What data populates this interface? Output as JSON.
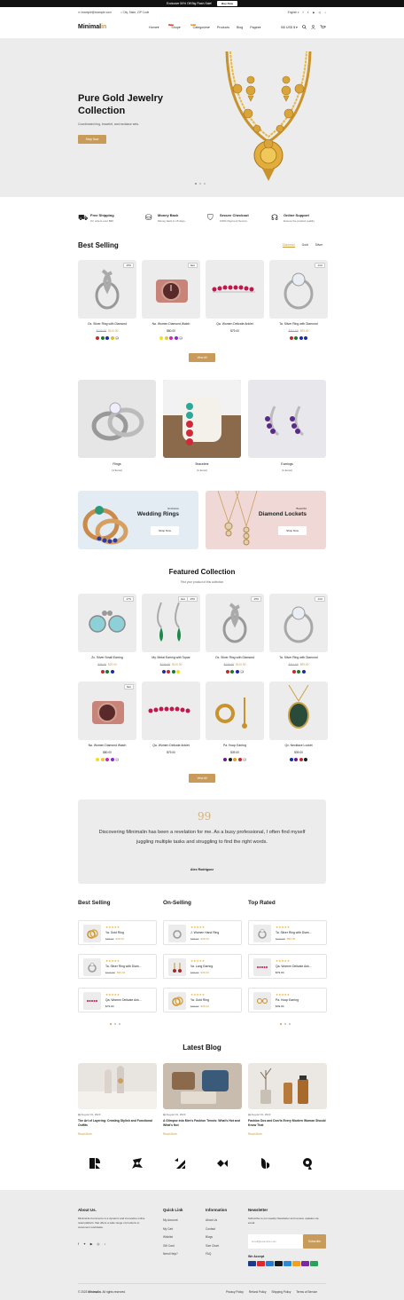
{
  "topbar": {
    "promo": "Exclusive 50% Off Big Flash Sale!",
    "buy": "Buy Now"
  },
  "infobar": {
    "email": "example@example.com",
    "address": "City, State, ZIP Code",
    "language": "English"
  },
  "header": {
    "logo_main": "Minimal",
    "logo_accent": "in",
    "currency": "BD USD $",
    "cart_count": "0",
    "nav": [
      {
        "label": "Home",
        "caret": "▾"
      },
      {
        "label": "Shop",
        "caret": "▾",
        "tag": "Sale"
      },
      {
        "label": "Categories",
        "caret": "▾",
        "tag": "New"
      },
      {
        "label": "Products"
      },
      {
        "label": "Blog"
      },
      {
        "label": "Pages",
        "caret": "▾"
      }
    ]
  },
  "hero": {
    "title": "Pure Gold Jewelry Collection",
    "subtitle": "Coordinated ring, bracelet, and necklace sets.",
    "button": "Shop Now"
  },
  "features": [
    {
      "icon": "truck-icon",
      "title": "Free Shipping",
      "sub": "On orders over $99."
    },
    {
      "icon": "money-icon",
      "title": "Money Back",
      "sub": "Money back in 15 days."
    },
    {
      "icon": "secure-icon",
      "title": "Secure Checkout",
      "sub": "100% Payment Secure."
    },
    {
      "icon": "support-icon",
      "title": "Online Support",
      "sub": "Ensure the product quality"
    }
  ],
  "best_selling": {
    "title": "Best Selling",
    "tabs": [
      "Diamond",
      "Gold",
      "Silver"
    ],
    "products": [
      {
        "name": "Ox. Silver Ring with Diamond",
        "old": "$130.00",
        "new": "$110.00",
        "badge": "-15%",
        "more": "+2",
        "colors": [
          "#c02a2a",
          "#1a7a2a",
          "#1a2aa8",
          "#e0c020"
        ]
      },
      {
        "name": "Na. Women Diamond Watch",
        "new": "$80.00",
        "badge": "New",
        "more": "+1",
        "colors": [
          "#f2e21a",
          "#e8c83a",
          "#d02ab0",
          "#8a2ad0"
        ]
      },
      {
        "name": "Qa. Women Delicate Anklet",
        "new": "$79.00",
        "colors": []
      },
      {
        "name": "Ta. Silver Ring with Diamond",
        "old": "$111.00",
        "new": "$99.00",
        "badge": "-11%",
        "colors": [
          "#c02a2a",
          "#1a7a2a",
          "#1a2aa8",
          "#1a2aa8"
        ]
      }
    ],
    "view_all": "View All"
  },
  "categories": [
    {
      "name": "Rings",
      "count": "(4 Items)"
    },
    {
      "name": "Bracelets",
      "count": "(1 Items)"
    },
    {
      "name": "Earrings",
      "count": "(1 Items)"
    }
  ],
  "banners": [
    {
      "exclusive": "Exclusive",
      "title": "Wedding Rings",
      "button": "Shop Now"
    },
    {
      "exclusive": "Beautiful",
      "title": "Diamond Lockets",
      "button": "Shop Now"
    }
  ],
  "featured": {
    "title": "Featured Collection",
    "subtitle": "Find your product of this collection",
    "products": [
      {
        "name": "Zc. Silver Small Earring",
        "old": "$25.00",
        "new": "$20.00",
        "badge": "-17%",
        "colors": [
          "#c02a2a",
          "#1a7a2a",
          "#1a2aa8"
        ]
      },
      {
        "name": "My. Metal Earring with Topaz",
        "old": "$130.00",
        "new": "$110.00",
        "badge": "-15%",
        "badge2": "New",
        "colors": [
          "#1a2aa8",
          "#c02a2a",
          "#1a7a2a",
          "#f2e21a"
        ]
      },
      {
        "name": "Ox. Silver Ring with Diamond",
        "old": "$130.00",
        "new": "$110.00",
        "badge": "-15%",
        "more": "+2",
        "colors": [
          "#c02a2a",
          "#1a7a2a",
          "#1a2aa8"
        ]
      },
      {
        "name": "Ta. Silver Ring with Diamond",
        "old": "$111.00",
        "new": "$99.00",
        "badge": "-11%",
        "colors": [
          "#c02a2a",
          "#1a7a2a",
          "#1a2aa8"
        ]
      },
      {
        "name": "Na. Women Diamond Watch",
        "new": "$80.00",
        "badge": "New",
        "more": "+1",
        "colors": [
          "#f2e21a",
          "#e8c83a",
          "#d02ab0",
          "#8a2ad0"
        ]
      },
      {
        "name": "Qa. Women Delicate Anklet",
        "new": "$79.00",
        "colors": []
      },
      {
        "name": "Pa. Hoop Earring",
        "new": "$39.00",
        "more": "+1",
        "colors": [
          "#6a1a8a",
          "#1a1a1a",
          "#e0a02a",
          "#c02a2a"
        ]
      },
      {
        "name": "Qx. Necklace Locket",
        "new": "$39.00",
        "colors": [
          "#1a2aa8",
          "#6a1a8a",
          "#c02a2a",
          "#1a1a1a"
        ]
      }
    ],
    "view_all": "View All"
  },
  "testimonial": {
    "quote_mark": "99",
    "text": "Discovering Minimalin has been a revelation for me. As a busy professional, I often find myself juggling multiple tasks and struggling to find the right words.",
    "author": "Alex Rodriguez"
  },
  "lists": [
    {
      "title": "Best Selling",
      "items": [
        {
          "name": "Ya. Gold Ring",
          "old": "$45.00",
          "new": "$39.00"
        },
        {
          "name": "Ta. Silver Ring with Diam...",
          "old": "$111.00",
          "new": "$99.00"
        },
        {
          "name": "Qa. Women Delicate Ank...",
          "new": "$79.00"
        }
      ]
    },
    {
      "title": "On-Selling",
      "items": [
        {
          "name": "J. Women Hand Ring",
          "old": "$45.00",
          "new": "$39.00"
        },
        {
          "name": "Va. Long Earring",
          "old": "$45.00",
          "new": "$39.00"
        },
        {
          "name": "Ya. Gold Ring",
          "old": "$45.00",
          "new": "$39.00"
        }
      ]
    },
    {
      "title": "Top Rated",
      "items": [
        {
          "name": "Ta. Silver Ring with Diam...",
          "old": "$111.00",
          "new": "$99.00"
        },
        {
          "name": "Qa. Women Delicate Ank...",
          "new": "$79.00"
        },
        {
          "name": "Pa. Hoop Earring",
          "new": "$39.00"
        }
      ]
    }
  ],
  "stars": "★★★★★",
  "blog": {
    "title": "Latest Blog",
    "posts": [
      {
        "date": "August 01, 2023",
        "title": "The Art of Layering: Creating Stylish and Functional Outfits",
        "read": "Read More"
      },
      {
        "date": "August 01, 2023",
        "title": "A Glimpse into Men's Fashion Trends: What's Hot and What's Not",
        "read": "Read More"
      },
      {
        "date": "August 01, 2023",
        "title": "Fashion Dos and Don'ts Every Modern Woman Should Know That",
        "read": "Read More"
      }
    ]
  },
  "footer": {
    "about_title": "About Us.",
    "about_text": "Minimal E-Commerce is a dynamic and innovative online retail platform that offers a wide range of products to customers worldwide.",
    "quick_title": "Quick Link",
    "quick": [
      "My Account",
      "My Cart",
      "Wishlist",
      "Gift Card",
      "Need Help?"
    ],
    "info_title": "Information",
    "info": [
      "About Us",
      "Contact",
      "Blogs",
      "Size Chart",
      "FAQ"
    ],
    "news_title": "Newsletter",
    "news_text": "Subscribe to our weekly Newsletter and receive updates via email.",
    "email_placeholder": "email@example.com",
    "subscribe": "Subscribe",
    "we_accept": "We Accept",
    "copyright_prefix": "© 2023 ",
    "copyright_brand": "Minimalin",
    "copyright_suffix": ". All rights reserved.",
    "legal": [
      "Privacy Policy",
      "Refund Policy",
      "Shipping Policy",
      "Terms of Service"
    ]
  }
}
